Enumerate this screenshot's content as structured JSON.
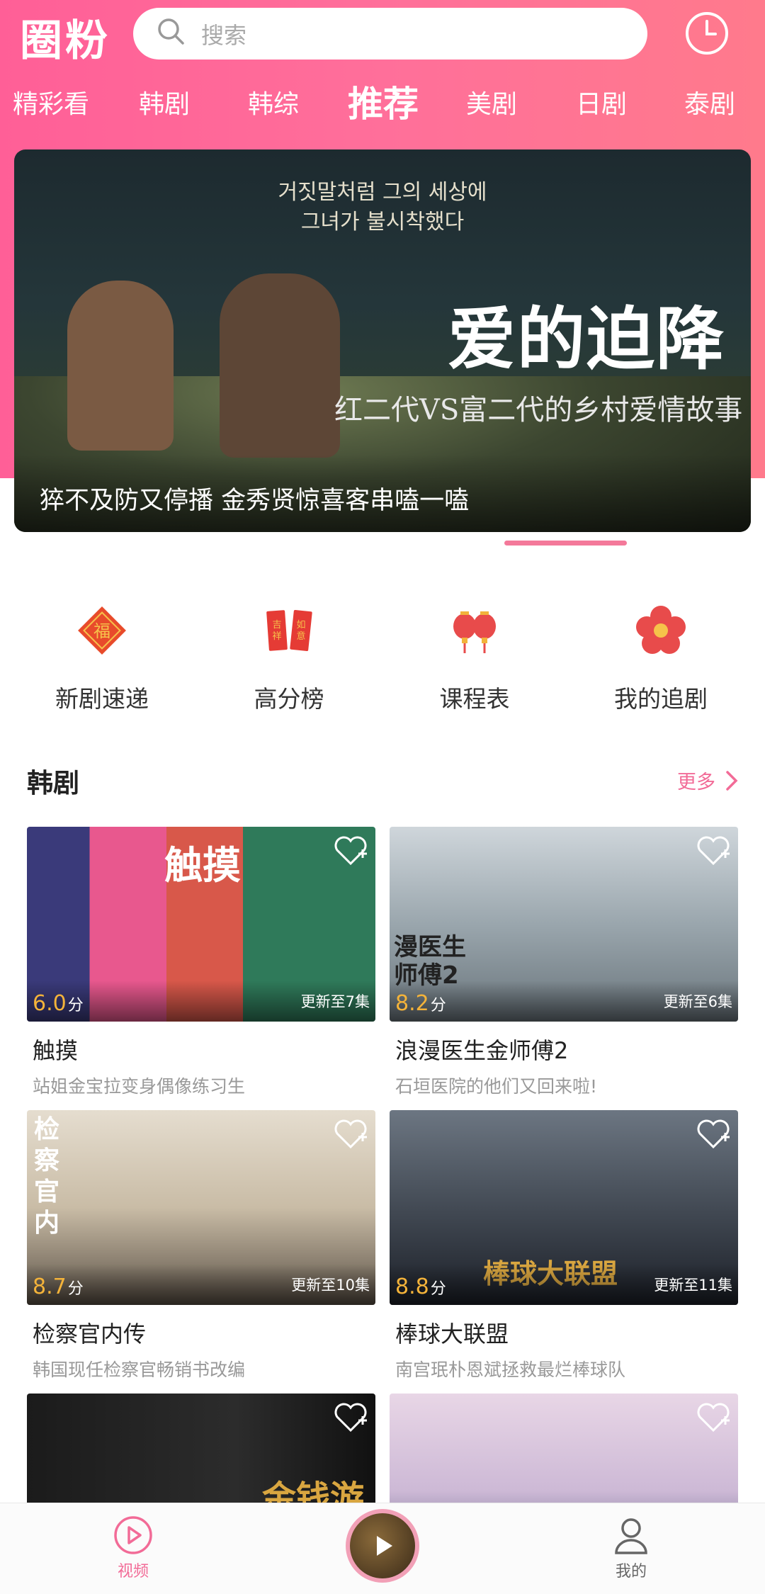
{
  "app": {
    "logo_text": "圈粉"
  },
  "search": {
    "placeholder": "搜索"
  },
  "tabs": [
    {
      "label": "精彩看"
    },
    {
      "label": "韩剧"
    },
    {
      "label": "韩综"
    },
    {
      "label": "推荐",
      "active": true
    },
    {
      "label": "美剧"
    },
    {
      "label": "日剧"
    },
    {
      "label": "泰剧"
    }
  ],
  "banner": {
    "korean_line1": "거짓말처럼 그의 세상에",
    "korean_line2": "그녀가 불시착했다",
    "title": "爱的迫降",
    "subtitle": "红二代VS富二代的乡村爱情故事",
    "caption": "猝不及防又停播 金秀贤惊喜客串嗑一嗑"
  },
  "quick_nav": [
    {
      "label": "新剧速递",
      "icon": "diamond-fortune-icon"
    },
    {
      "label": "高分榜",
      "icon": "red-envelope-icon"
    },
    {
      "label": "课程表",
      "icon": "lantern-icon"
    },
    {
      "label": "我的追剧",
      "icon": "plum-blossom-icon"
    }
  ],
  "section": {
    "title": "韩剧",
    "more": "更多"
  },
  "shows": [
    {
      "name": "触摸",
      "desc": "站姐金宝拉变身偶像练习生",
      "score": "6.0",
      "unit": "分",
      "update": "更新至7集",
      "poster_text": "触摸"
    },
    {
      "name": "浪漫医生金师傅2",
      "desc": "石垣医院的他们又回来啦!",
      "score": "8.2",
      "unit": "分",
      "update": "更新至6集",
      "poster_text": "漫医生 师傅2"
    },
    {
      "name": "检察官内传",
      "desc": "韩国现任检察官畅销书改编",
      "score": "8.7",
      "unit": "分",
      "update": "更新至10集",
      "poster_text": "检察官内"
    },
    {
      "name": "棒球大联盟",
      "desc": "南宫珉朴恩斌拯救最烂棒球队",
      "score": "8.8",
      "unit": "分",
      "update": "更新至11集",
      "poster_text": "棒球大联盟"
    },
    {
      "name": "",
      "desc": "",
      "score": "",
      "unit": "",
      "update": "",
      "poster_text": "金钱游"
    },
    {
      "name": "",
      "desc": "",
      "score": "",
      "unit": "",
      "update": "",
      "poster_text": ""
    }
  ],
  "bottom_nav": {
    "video": "视频",
    "mine": "我的"
  },
  "colors": {
    "brand": "#ff6a99",
    "score": "#f4b33a",
    "more": "#f26b97"
  }
}
